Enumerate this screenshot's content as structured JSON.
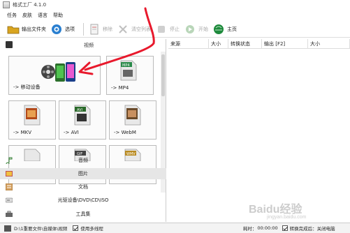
{
  "window": {
    "title": "格式工厂 4.1.0"
  },
  "menu": [
    "任务",
    "皮肤",
    "语言",
    "帮助"
  ],
  "toolbar": {
    "output_folder": "输出文件夹",
    "options": "选项",
    "remove": "移除",
    "clear_list": "清空列表",
    "stop": "停止",
    "start": "开始",
    "home": "主页"
  },
  "left": {
    "video_section_title": "视频",
    "formats": [
      {
        "label": "-> 移动设备",
        "icon": "mobile-device-icon"
      },
      {
        "label": "-> MP4",
        "icon": "mp4-icon"
      },
      {
        "label": "-> MKV",
        "icon": "mkv-icon"
      },
      {
        "label": "-> AVI",
        "icon": "avi-icon"
      },
      {
        "label": "-> WebM",
        "icon": "webm-icon"
      },
      {
        "label": "",
        "icon": "file-icon"
      },
      {
        "label": "GIF",
        "icon": "gif-icon"
      },
      {
        "label": "WMV",
        "icon": "wmv-icon"
      }
    ],
    "categories": [
      "音频",
      "图片",
      "文档",
      "光驱设备\\DVD\\CD\\ISO",
      "工具集"
    ]
  },
  "table": {
    "columns": [
      "来源",
      "大小",
      "转换状态",
      "输出 [F2]",
      "大小"
    ]
  },
  "status": {
    "path": "D:\\1重要文件\\自媒体\\视频",
    "multithread": "使用多线程",
    "elapsed_label": "耗时：",
    "elapsed": "00:00:00",
    "after_done": "转换完成后：关闭电脑",
    "watermark": "Baidu经验",
    "watermark_sub": "jingyan.baidu.com"
  },
  "colors": {
    "annotation_arrow": "#e8192c",
    "selected_row": "#e6e6e6"
  }
}
